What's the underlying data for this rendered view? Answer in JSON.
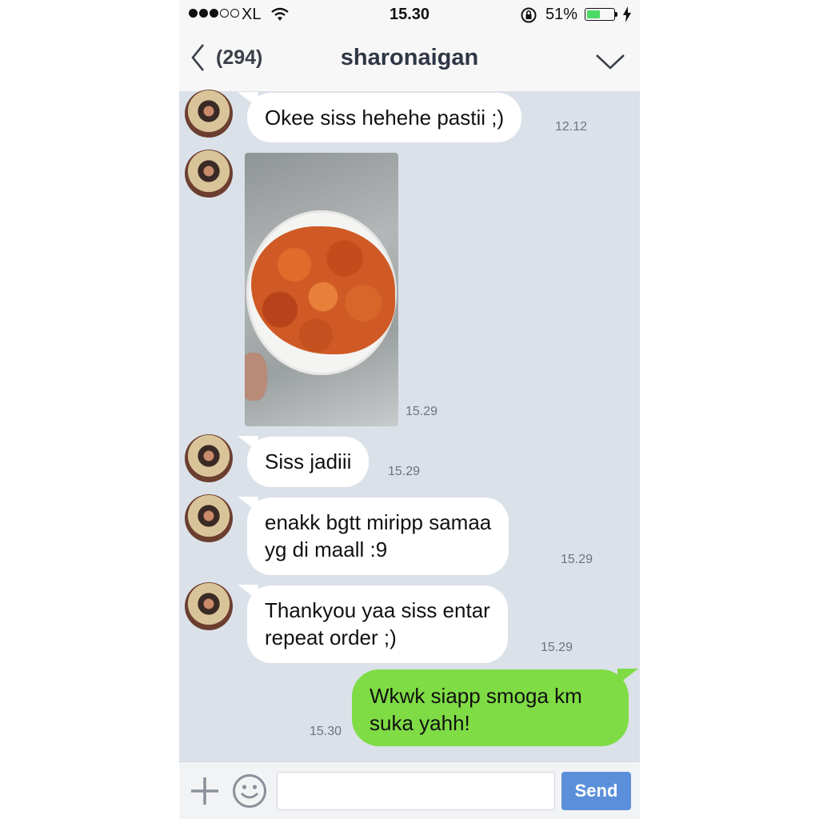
{
  "status_bar": {
    "signal_filled": 3,
    "signal_total": 5,
    "carrier": "XL",
    "time": "15.30",
    "battery_percent": "51%",
    "battery_level": 0.51,
    "battery_color": "#4cd964"
  },
  "nav": {
    "back_count": "(294)",
    "title": "sharonaigan",
    "icons": {
      "back": "chevron-left-icon",
      "menu": "chevron-down-icon"
    }
  },
  "messages": [
    {
      "text_lines": [
        "Okee siss hehehe pastii ;)"
      ],
      "time": "12.12"
    },
    {
      "type": "image",
      "description_icon": "food-photo",
      "time": "15.29"
    },
    {
      "text_lines": [
        "Siss jadiii"
      ],
      "time": "15.29"
    },
    {
      "text_lines": [
        "enakk bgtt miripp samaa",
        "yg di maall :9"
      ],
      "time": "15.29"
    },
    {
      "text_lines": [
        "Thankyou yaa siss entar",
        "repeat order ;)"
      ],
      "time": "15.29"
    }
  ],
  "outgoing": {
    "text_lines": [
      "Wkwk siapp smoga km",
      "suka yahh!"
    ],
    "time": "15.30",
    "color": "#7fdc45"
  },
  "input_bar": {
    "value": "",
    "send_label": "Send",
    "send_color": "#5b8fd9",
    "icons": {
      "plus": "plus-icon",
      "emoji": "smiley-icon"
    }
  }
}
